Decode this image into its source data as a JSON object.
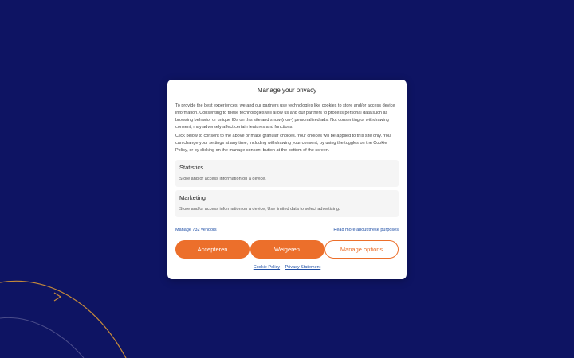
{
  "modal": {
    "title": "Manage your privacy",
    "paragraph1": "To provide the best experiences, we and our partners use technologies like cookies to store and/or access device information. Consenting to these technologies will allow us and our partners to process personal data such as browsing behavior or unique IDs on this site and show (non-) personalized ads. Not consenting or withdrawing consent, may adversely affect certain features and functions.",
    "paragraph2": "Click below to consent to the above or make granular choices. Your choices will be applied to this site only. You can change your settings at any time, including withdrawing your consent, by using the toggles on the Cookie Policy, or by clicking on the manage consent button at the bottom of the screen.",
    "sections": [
      {
        "title": "Statistics",
        "description": "Store and/or access information on a device."
      },
      {
        "title": "Marketing",
        "description": "Store and/or access information on a device, Use limited data to select advertising."
      }
    ],
    "manage_vendors_link": "Manage 732 vendors",
    "read_more_link": "Read more about these purposes",
    "buttons": {
      "accept": "Accepteren",
      "decline": "Weigeren",
      "manage": "Manage options"
    },
    "footer_links": {
      "cookie_policy": "Cookie Policy",
      "privacy_statement": "Privacy Statement"
    }
  },
  "colors": {
    "background": "#0e1463",
    "accent": "#ec6f2b",
    "link": "#1f4fa6"
  }
}
